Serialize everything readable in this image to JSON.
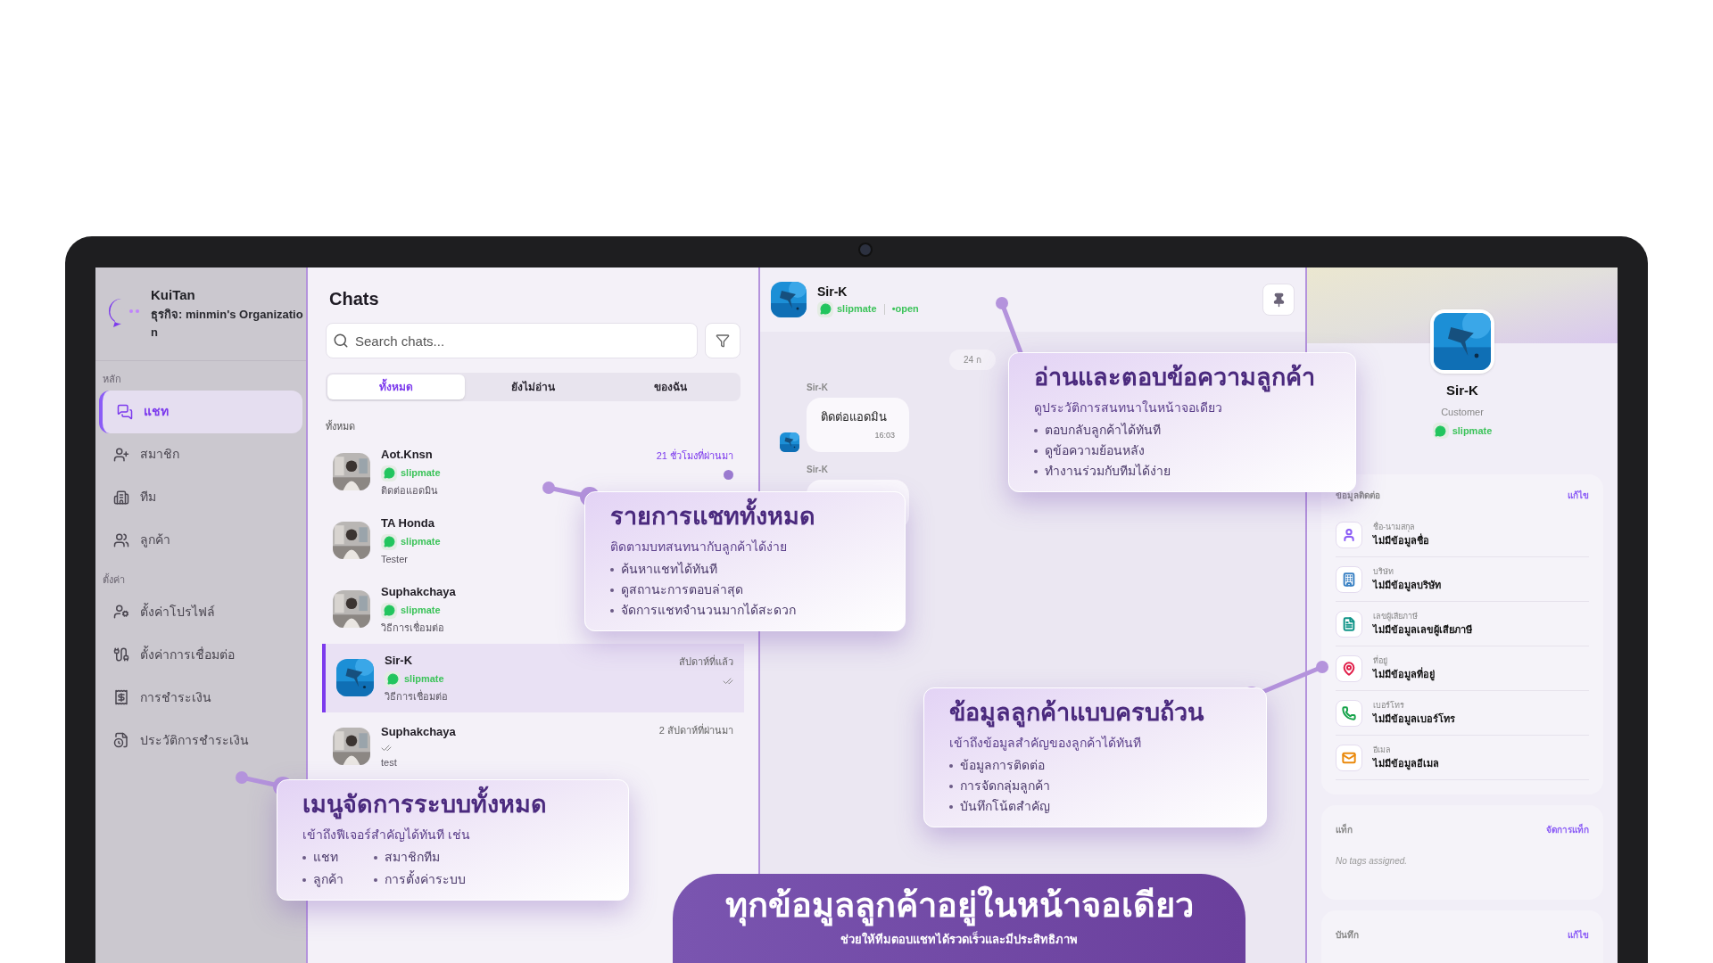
{
  "sidebar": {
    "user": "KuiTan",
    "org": "ธุรกิจ: minmin's Organization",
    "sections": [
      {
        "label": "หลัก",
        "items": [
          {
            "label": "แชท",
            "selected": true
          },
          {
            "label": "สมาชิก",
            "selected": false
          },
          {
            "label": "ทีม",
            "selected": false
          },
          {
            "label": "ลูกค้า",
            "selected": false
          }
        ]
      },
      {
        "label": "ตั้งค่า",
        "items": [
          {
            "label": "ตั้งค่าโปรไฟล์",
            "selected": false
          },
          {
            "label": "ตั้งค่าการเชื่อมต่อ",
            "selected": false
          },
          {
            "label": "การชำระเงิน",
            "selected": false
          },
          {
            "label": "ประวัติการชำระเงิน",
            "selected": false
          }
        ]
      }
    ]
  },
  "chat_list": {
    "title": "Chats",
    "search": {
      "placeholder": "Search chats..."
    },
    "tabs": [
      {
        "label": "ทั้งหมด",
        "selected": true
      },
      {
        "label": "ยังไม่อ่าน",
        "selected": false
      },
      {
        "label": "ของฉัน",
        "selected": false
      }
    ],
    "section_label": "ทั้งหมด",
    "rows": [
      {
        "name": "Aot.Knsn",
        "channel": "slipmate",
        "preview": "ติดต่อแอดมิน",
        "time": "21 ชั่วโมงที่ผ่านมา",
        "unread": true,
        "read": false,
        "selected": false
      },
      {
        "name": "TA Honda",
        "channel": "slipmate",
        "preview": "Tester",
        "unread": false,
        "read": false,
        "selected": false
      },
      {
        "name": "Suphakchaya",
        "channel": "slipmate",
        "preview": "วิธีการเชื่อมต่อ",
        "unread": false,
        "read": false,
        "selected": false
      },
      {
        "name": "Sir-K",
        "channel": "slipmate",
        "preview": "วิธีการเชื่อมต่อ",
        "time": "สัปดาห์ที่แล้ว",
        "unread": false,
        "read": true,
        "selected": true
      },
      {
        "name": "Suphakchaya",
        "preview": "test",
        "time": "2 สัปดาห์ที่ผ่านมา",
        "unread": false,
        "read": true,
        "selected": false
      }
    ]
  },
  "conversation": {
    "name": "Sir-K",
    "channel": "slipmate",
    "status": "•open",
    "date": "24 ก",
    "messages": [
      {
        "sender": "Sir-K",
        "text": "ติดต่อแอดมิน",
        "time": "16:03"
      },
      {
        "sender": "Sir-K"
      }
    ]
  },
  "customer": {
    "name": "Sir-K",
    "role": "Customer",
    "channel": "slipmate",
    "contact": {
      "title": "ข้อมูลติดต่อ",
      "action": "แก้ไข",
      "fields": [
        {
          "label": "ชื่อ-นามสกุล",
          "value": "ไม่มีข้อมูลชื่อ",
          "color": "#8b5cf6"
        },
        {
          "label": "บริษัท",
          "value": "ไม่มีข้อมูลบริษัท",
          "color": "#3b82c4"
        },
        {
          "label": "เลขผู้เสียภาษี",
          "value": "ไม่มีข้อมูลเลขผู้เสียภาษี",
          "color": "#0f9488"
        },
        {
          "label": "ที่อยู่",
          "value": "ไม่มีข้อมูลที่อยู่",
          "color": "#e11d48"
        },
        {
          "label": "เบอร์โทร",
          "value": "ไม่มีข้อมูลเบอร์โทร",
          "color": "#16a34a"
        },
        {
          "label": "อีเมล",
          "value": "ไม่มีข้อมูลอีเมล",
          "color": "#ea8a0c"
        }
      ]
    },
    "tags": {
      "title": "แท็ก",
      "action": "จัดการแท็ก",
      "empty": "No tags assigned."
    },
    "notes": {
      "title": "บันทึก",
      "action": "แก้ไข"
    }
  },
  "callouts": [
    {
      "title": "อ่านและตอบข้อความลูกค้า",
      "subtitle": "ดูประวัติการสนทนาในหน้าจอเดียว",
      "kind": "list",
      "bullets": [
        "ตอบกลับลูกค้าได้ทันที",
        "ดูข้อความย้อนหลัง",
        "ทำงานร่วมกับทีมได้ง่าย"
      ]
    },
    {
      "title": "รายการแชททั้งหมด",
      "subtitle": "ติดตามบทสนทนากับลูกค้าได้ง่าย",
      "kind": "list",
      "bullets": [
        "ค้นหาแชทได้ทันที",
        "ดูสถานะการตอบล่าสุด",
        "จัดการแชทจำนวนมากได้สะดวก"
      ]
    },
    {
      "title": "ข้อมูลลูกค้าแบบครบถ้วน",
      "subtitle": "เข้าถึงข้อมูลสำคัญของลูกค้าได้ทันที",
      "kind": "list",
      "bullets": [
        "ข้อมูลการติดต่อ",
        "การจัดกลุ่มลูกค้า",
        "บันทึกโน้ตสำคัญ"
      ]
    },
    {
      "title": "เมนูจัดการระบบทั้งหมด",
      "subtitle": "เข้าถึงฟีเจอร์สำคัญได้ทันที เช่น",
      "kind": "grid",
      "bullets": [
        "แชท",
        "สมาชิกทีม",
        "ลูกค้า",
        "การตั้งค่าระบบ"
      ]
    }
  ],
  "banner": {
    "title": "ทุกข้อมูลลูกค้าอยู่ในหน้าจอเดียว",
    "subtitle": "ช่วยให้ทีมตอบแชทได้รวดเร็วและมีประสิทธิภาพ"
  }
}
